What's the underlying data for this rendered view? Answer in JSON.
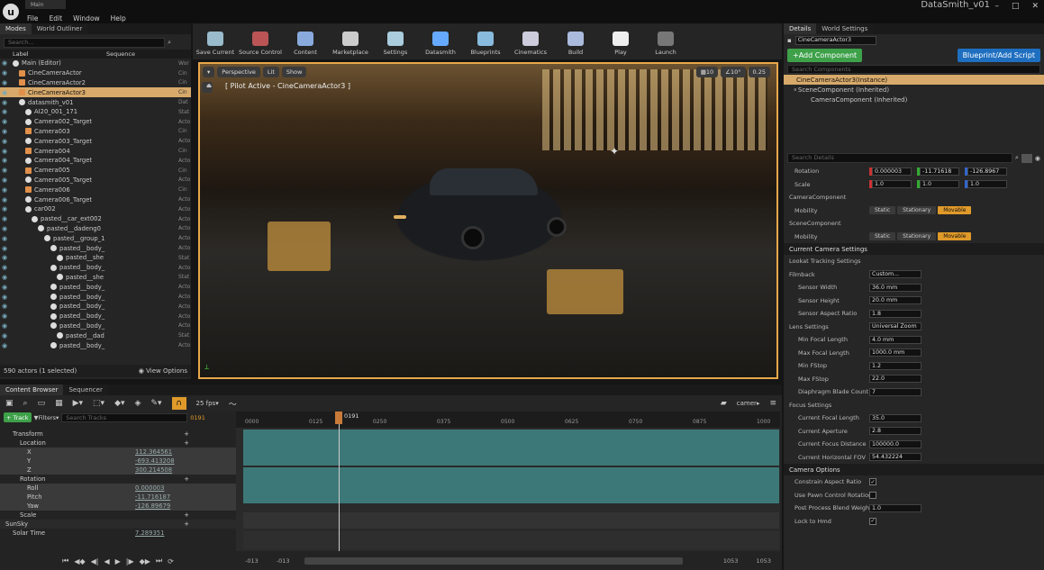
{
  "app": {
    "menu": [
      "File",
      "Edit",
      "Window",
      "Help"
    ],
    "doc_tab": "Main",
    "project": "DataSmith_v01"
  },
  "left": {
    "tabs": [
      "Modes",
      "World Outliner"
    ],
    "search_placeholder": "Search...",
    "col_label": "Label",
    "col_sequence": "Sequence",
    "rows": [
      {
        "n": "Main (Editor)",
        "t": "Wor",
        "d": 0,
        "k": "folder"
      },
      {
        "n": "CineCameraActor",
        "t": "Cin",
        "d": 1,
        "k": "cam"
      },
      {
        "n": "CineCameraActor2",
        "t": "Cin",
        "d": 1,
        "k": "cam"
      },
      {
        "n": "CineCameraActor3",
        "t": "Cin",
        "d": 1,
        "k": "cam",
        "sel": true
      },
      {
        "n": "datasmith_v01",
        "t": "Dat",
        "d": 1,
        "k": "mesh"
      },
      {
        "n": "AI20_001_171",
        "t": "Stat",
        "d": 2,
        "k": "mesh"
      },
      {
        "n": "Camera002_Target",
        "t": "Acto",
        "d": 2,
        "k": "mesh"
      },
      {
        "n": "Camera003",
        "t": "Cin",
        "d": 2,
        "k": "cam"
      },
      {
        "n": "Camera003_Target",
        "t": "Acto",
        "d": 2,
        "k": "mesh"
      },
      {
        "n": "Camera004",
        "t": "Cin",
        "d": 2,
        "k": "cam"
      },
      {
        "n": "Camera004_Target",
        "t": "Acto",
        "d": 2,
        "k": "mesh"
      },
      {
        "n": "Camera005",
        "t": "Cin",
        "d": 2,
        "k": "cam"
      },
      {
        "n": "Camera005_Target",
        "t": "Acto",
        "d": 2,
        "k": "mesh"
      },
      {
        "n": "Camera006",
        "t": "Cin",
        "d": 2,
        "k": "cam"
      },
      {
        "n": "Camera006_Target",
        "t": "Acto",
        "d": 2,
        "k": "mesh"
      },
      {
        "n": "car002",
        "t": "Acto",
        "d": 2,
        "k": "mesh"
      },
      {
        "n": "pasted__car_ext002",
        "t": "Acto",
        "d": 3,
        "k": "mesh"
      },
      {
        "n": "pasted__dadeng0",
        "t": "Acto",
        "d": 4,
        "k": "mesh"
      },
      {
        "n": "pasted__group_1",
        "t": "Acto",
        "d": 5,
        "k": "mesh"
      },
      {
        "n": "pasted__body_",
        "t": "Acto",
        "d": 6,
        "k": "mesh"
      },
      {
        "n": "pasted__she",
        "t": "Stat",
        "d": 7,
        "k": "mesh"
      },
      {
        "n": "pasted__body_",
        "t": "Acto",
        "d": 6,
        "k": "mesh"
      },
      {
        "n": "pasted__she",
        "t": "Stat",
        "d": 7,
        "k": "mesh"
      },
      {
        "n": "pasted__body_",
        "t": "Acto",
        "d": 6,
        "k": "mesh"
      },
      {
        "n": "pasted__body_",
        "t": "Acto",
        "d": 6,
        "k": "mesh"
      },
      {
        "n": "pasted__body_",
        "t": "Acto",
        "d": 6,
        "k": "mesh"
      },
      {
        "n": "pasted__body_",
        "t": "Acto",
        "d": 6,
        "k": "mesh"
      },
      {
        "n": "pasted__body_",
        "t": "Acto",
        "d": 6,
        "k": "mesh"
      },
      {
        "n": "pasted__dad",
        "t": "Stat",
        "d": 7,
        "k": "mesh"
      },
      {
        "n": "pasted__body_",
        "t": "Acto",
        "d": 6,
        "k": "mesh"
      }
    ],
    "status": "590 actors (1 selected)",
    "view_options": "View Options"
  },
  "toolbar": [
    "Save Current",
    "Source Control",
    "Content",
    "Marketplace",
    "Settings",
    "Datasmith",
    "Blueprints",
    "Cinematics",
    "Build",
    "Play",
    "Launch"
  ],
  "viewport": {
    "perspective": "Perspective",
    "lit": "Lit",
    "show": "Show",
    "pilot": "[ Pilot Active - CineCameraActor3 ]",
    "grid": "10",
    "angle": "10°",
    "scale": "0.25"
  },
  "right": {
    "tabs": [
      "Details",
      "World Settings"
    ],
    "actor_name": "CineCameraActor3",
    "add_component": "+Add Component",
    "blueprint": "Blueprint/Add Script",
    "search_components": "Search Components",
    "instance": "CineCameraActor3(Instance)",
    "scene": "SceneComponent (Inherited)",
    "camera_comp": "CameraComponent (Inherited)",
    "search_details": "Search Details",
    "rotation": {
      "label": "Rotation",
      "x": "0.000003",
      "y": "-11.71618",
      "z": "-126.8967"
    },
    "scale": {
      "label": "Scale",
      "x": "1.0",
      "y": "1.0",
      "z": "1.0"
    },
    "cam_comp": "CameraComponent",
    "scene_comp": "SceneComponent",
    "mobility": "Mobility",
    "mob": [
      "Static",
      "Stationary",
      "Movable"
    ],
    "sections": {
      "ccs": "Current Camera Settings",
      "lookat": "Lookat Tracking Settings",
      "filmback": "Filmback",
      "lens": "Lens Settings",
      "focus": "Focus Settings",
      "camopts": "Camera Options"
    },
    "filmback_val": "Custom...",
    "fb": [
      {
        "l": "Sensor Width",
        "v": "36.0 mm"
      },
      {
        "l": "Sensor Height",
        "v": "20.0 mm"
      },
      {
        "l": "Sensor Aspect Ratio",
        "v": "1.8"
      }
    ],
    "lens_val": "Universal Zoom",
    "lens": [
      {
        "l": "Min Focal Length",
        "v": "4.0 mm"
      },
      {
        "l": "Max Focal Length",
        "v": "1000.0 mm"
      },
      {
        "l": "Min FStop",
        "v": "1.2"
      },
      {
        "l": "Max FStop",
        "v": "22.0"
      },
      {
        "l": "Diaphragm Blade Count",
        "v": "7"
      }
    ],
    "cur": [
      {
        "l": "Current Focal Length",
        "v": "35.0"
      },
      {
        "l": "Current Aperture",
        "v": "2.8"
      },
      {
        "l": "Current Focus Distance",
        "v": "100000.0"
      },
      {
        "l": "Current Horizontal FOV",
        "v": "54.432224"
      }
    ],
    "opts": [
      {
        "l": "Constrain Aspect Ratio",
        "v": "✓"
      },
      {
        "l": "Use Pawn Control Rotation",
        "v": ""
      },
      {
        "l": "Post Process Blend Weight",
        "v": "1.0"
      },
      {
        "l": "Lock to Hmd",
        "v": "✓"
      }
    ]
  },
  "bottom": {
    "tabs": [
      "Content Browser",
      "Sequencer"
    ],
    "fps": "25 fps",
    "cam": "camer",
    "track": "+ Track",
    "filters": "Filters",
    "search_tracks": "Search Tracks",
    "frame": "0191",
    "playhead": "0191",
    "ticks": [
      "0000",
      "0125",
      "0250",
      "0375",
      "0500",
      "0625",
      "0750",
      "0875",
      "1000"
    ],
    "tracks": [
      {
        "n": "Transform",
        "d": 1
      },
      {
        "n": "Location",
        "d": 2
      },
      {
        "n": "X",
        "d": 3,
        "v": "112.364561"
      },
      {
        "n": "Y",
        "d": 3,
        "v": "-693.413208"
      },
      {
        "n": "Z",
        "d": 3,
        "v": "300.214508"
      },
      {
        "n": "Rotation",
        "d": 2
      },
      {
        "n": "Roll",
        "d": 3,
        "v": "0.000003"
      },
      {
        "n": "Pitch",
        "d": 3,
        "v": "-11.716187"
      },
      {
        "n": "Yaw",
        "d": 3,
        "v": "-126.89679"
      },
      {
        "n": "Scale",
        "d": 2
      },
      {
        "n": "SunSky",
        "d": 0
      },
      {
        "n": "Solar Time",
        "d": 1,
        "v": "7.289351"
      }
    ],
    "range": [
      "-013",
      "-013",
      "1053",
      "1053"
    ]
  }
}
